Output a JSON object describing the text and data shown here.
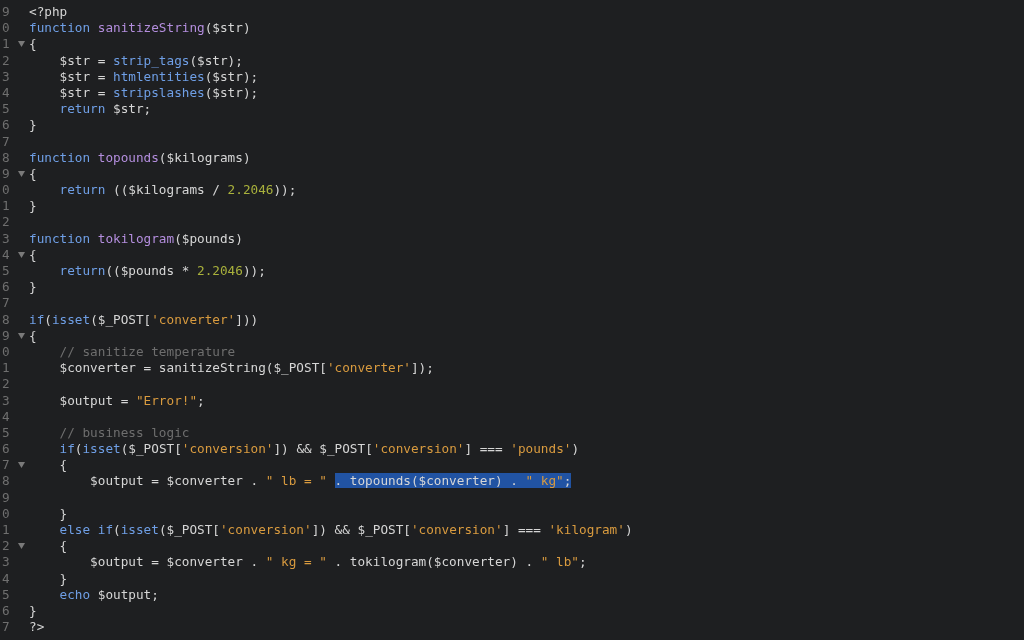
{
  "editor": {
    "lines": [
      {
        "number": "9",
        "foldable": false,
        "tokens": [
          {
            "kind": "plain",
            "text": "<?php",
            "selected": false
          }
        ]
      },
      {
        "number": "0",
        "foldable": false,
        "tokens": [
          {
            "kind": "keyword",
            "text": "function ",
            "selected": false
          },
          {
            "kind": "func",
            "text": "sanitizeString",
            "selected": false
          },
          {
            "kind": "plain",
            "text": "($str)",
            "selected": false
          }
        ]
      },
      {
        "number": "1",
        "foldable": true,
        "tokens": [
          {
            "kind": "plain",
            "text": "{",
            "selected": false
          }
        ]
      },
      {
        "number": "2",
        "foldable": false,
        "tokens": [
          {
            "kind": "plain",
            "text": "    $str = ",
            "selected": false
          },
          {
            "kind": "keyword",
            "text": "strip_tags",
            "selected": false
          },
          {
            "kind": "plain",
            "text": "($str);",
            "selected": false
          }
        ]
      },
      {
        "number": "3",
        "foldable": false,
        "tokens": [
          {
            "kind": "plain",
            "text": "    $str = ",
            "selected": false
          },
          {
            "kind": "keyword",
            "text": "htmlentities",
            "selected": false
          },
          {
            "kind": "plain",
            "text": "($str);",
            "selected": false
          }
        ]
      },
      {
        "number": "4",
        "foldable": false,
        "tokens": [
          {
            "kind": "plain",
            "text": "    $str = ",
            "selected": false
          },
          {
            "kind": "keyword",
            "text": "stripslashes",
            "selected": false
          },
          {
            "kind": "plain",
            "text": "($str);",
            "selected": false
          }
        ]
      },
      {
        "number": "5",
        "foldable": false,
        "tokens": [
          {
            "kind": "keyword",
            "text": "    return",
            "selected": false
          },
          {
            "kind": "plain",
            "text": " $str;",
            "selected": false
          }
        ]
      },
      {
        "number": "6",
        "foldable": false,
        "tokens": [
          {
            "kind": "plain",
            "text": "}",
            "selected": false
          }
        ]
      },
      {
        "number": "7",
        "foldable": false
      },
      {
        "number": "8",
        "foldable": false,
        "tokens": [
          {
            "kind": "keyword",
            "text": "function ",
            "selected": false
          },
          {
            "kind": "func",
            "text": "topounds",
            "selected": false
          },
          {
            "kind": "plain",
            "text": "($kilograms)",
            "selected": false
          }
        ]
      },
      {
        "number": "9",
        "foldable": true,
        "tokens": [
          {
            "kind": "plain",
            "text": "{",
            "selected": false
          }
        ]
      },
      {
        "number": "0",
        "foldable": false,
        "tokens": [
          {
            "kind": "keyword",
            "text": "    return",
            "selected": false
          },
          {
            "kind": "plain",
            "text": " (($kilograms / ",
            "selected": false
          },
          {
            "kind": "number",
            "text": "2.2046",
            "selected": false
          },
          {
            "kind": "plain",
            "text": "));",
            "selected": false
          }
        ]
      },
      {
        "number": "1",
        "foldable": false,
        "tokens": [
          {
            "kind": "plain",
            "text": "}",
            "selected": false
          }
        ]
      },
      {
        "number": "2",
        "foldable": false
      },
      {
        "number": "3",
        "foldable": false,
        "tokens": [
          {
            "kind": "keyword",
            "text": "function ",
            "selected": false
          },
          {
            "kind": "func",
            "text": "tokilogram",
            "selected": false
          },
          {
            "kind": "plain",
            "text": "($pounds)",
            "selected": false
          }
        ]
      },
      {
        "number": "4",
        "foldable": true,
        "tokens": [
          {
            "kind": "plain",
            "text": "{",
            "selected": false
          }
        ]
      },
      {
        "number": "5",
        "foldable": false,
        "tokens": [
          {
            "kind": "keyword",
            "text": "    return",
            "selected": false
          },
          {
            "kind": "plain",
            "text": "(($pounds * ",
            "selected": false
          },
          {
            "kind": "number",
            "text": "2.2046",
            "selected": false
          },
          {
            "kind": "plain",
            "text": "));",
            "selected": false
          }
        ]
      },
      {
        "number": "6",
        "foldable": false,
        "tokens": [
          {
            "kind": "plain",
            "text": "}",
            "selected": false
          }
        ]
      },
      {
        "number": "7",
        "foldable": false
      },
      {
        "number": "8",
        "foldable": false,
        "tokens": [
          {
            "kind": "keyword",
            "text": "if",
            "selected": false
          },
          {
            "kind": "plain",
            "text": "(",
            "selected": false
          },
          {
            "kind": "keyword",
            "text": "isset",
            "selected": false
          },
          {
            "kind": "plain",
            "text": "($_POST[",
            "selected": false
          },
          {
            "kind": "string",
            "text": "'converter'",
            "selected": false
          },
          {
            "kind": "plain",
            "text": "]))",
            "selected": false
          }
        ]
      },
      {
        "number": "9",
        "foldable": true,
        "tokens": [
          {
            "kind": "plain",
            "text": "{",
            "selected": false
          }
        ]
      },
      {
        "number": "0",
        "foldable": false,
        "tokens": [
          {
            "kind": "comment",
            "text": "    // sanitize temperature",
            "selected": false
          }
        ]
      },
      {
        "number": "1",
        "foldable": false,
        "tokens": [
          {
            "kind": "plain",
            "text": "    $converter = sanitizeString($_POST[",
            "selected": false
          },
          {
            "kind": "string",
            "text": "'converter'",
            "selected": false
          },
          {
            "kind": "plain",
            "text": "]);",
            "selected": false
          }
        ]
      },
      {
        "number": "2",
        "foldable": false
      },
      {
        "number": "3",
        "foldable": false,
        "tokens": [
          {
            "kind": "plain",
            "text": "    $output = ",
            "selected": false
          },
          {
            "kind": "string",
            "text": "\"Error!\"",
            "selected": false
          },
          {
            "kind": "plain",
            "text": ";",
            "selected": false
          }
        ]
      },
      {
        "number": "4",
        "foldable": false
      },
      {
        "number": "5",
        "foldable": false,
        "tokens": [
          {
            "kind": "comment",
            "text": "    // business logic",
            "selected": false
          }
        ]
      },
      {
        "number": "6",
        "foldable": false,
        "tokens": [
          {
            "kind": "keyword",
            "text": "    if",
            "selected": false
          },
          {
            "kind": "plain",
            "text": "(",
            "selected": false
          },
          {
            "kind": "keyword",
            "text": "isset",
            "selected": false
          },
          {
            "kind": "plain",
            "text": "($_POST[",
            "selected": false
          },
          {
            "kind": "string",
            "text": "'conversion'",
            "selected": false
          },
          {
            "kind": "plain",
            "text": "]) && $_POST[",
            "selected": false
          },
          {
            "kind": "string",
            "text": "'conversion'",
            "selected": false
          },
          {
            "kind": "plain",
            "text": "] === ",
            "selected": false
          },
          {
            "kind": "string",
            "text": "'pounds'",
            "selected": false
          },
          {
            "kind": "plain",
            "text": ")",
            "selected": false
          }
        ]
      },
      {
        "number": "7",
        "foldable": true,
        "tokens": [
          {
            "kind": "plain",
            "text": "    {",
            "selected": false
          }
        ]
      },
      {
        "number": "8",
        "foldable": false,
        "tokens": [
          {
            "kind": "plain",
            "text": "        $output = $converter . ",
            "selected": false
          },
          {
            "kind": "string",
            "text": "\" lb = \" ",
            "selected": false
          },
          {
            "kind": "plain",
            "text": ". topounds($converter) . ",
            "selected": true
          },
          {
            "kind": "string",
            "text": "\" kg\"",
            "selected": true
          },
          {
            "kind": "plain",
            "text": ";",
            "selected": true
          }
        ]
      },
      {
        "number": "9",
        "foldable": false
      },
      {
        "number": "0",
        "foldable": false,
        "tokens": [
          {
            "kind": "plain",
            "text": "    }",
            "selected": false
          }
        ]
      },
      {
        "number": "1",
        "foldable": false,
        "tokens": [
          {
            "kind": "keyword",
            "text": "    else if",
            "selected": false
          },
          {
            "kind": "plain",
            "text": "(",
            "selected": false
          },
          {
            "kind": "keyword",
            "text": "isset",
            "selected": false
          },
          {
            "kind": "plain",
            "text": "($_POST[",
            "selected": false
          },
          {
            "kind": "string",
            "text": "'conversion'",
            "selected": false
          },
          {
            "kind": "plain",
            "text": "]) && $_POST[",
            "selected": false
          },
          {
            "kind": "string",
            "text": "'conversion'",
            "selected": false
          },
          {
            "kind": "plain",
            "text": "] === ",
            "selected": false
          },
          {
            "kind": "string",
            "text": "'kilogram'",
            "selected": false
          },
          {
            "kind": "plain",
            "text": ")",
            "selected": false
          }
        ]
      },
      {
        "number": "2",
        "foldable": true,
        "tokens": [
          {
            "kind": "plain",
            "text": "    {",
            "selected": false
          }
        ]
      },
      {
        "number": "3",
        "foldable": false,
        "tokens": [
          {
            "kind": "plain",
            "text": "        $output = $converter . ",
            "selected": false
          },
          {
            "kind": "string",
            "text": "\" kg = \"",
            "selected": false
          },
          {
            "kind": "plain",
            "text": " . tokilogram($converter) . ",
            "selected": false
          },
          {
            "kind": "string",
            "text": "\" lb\"",
            "selected": false
          },
          {
            "kind": "plain",
            "text": ";",
            "selected": false
          }
        ]
      },
      {
        "number": "4",
        "foldable": false,
        "tokens": [
          {
            "kind": "plain",
            "text": "    }",
            "selected": false
          }
        ]
      },
      {
        "number": "5",
        "foldable": false,
        "tokens": [
          {
            "kind": "keyword",
            "text": "    echo",
            "selected": false
          },
          {
            "kind": "plain",
            "text": " $output;",
            "selected": false
          }
        ]
      },
      {
        "number": "6",
        "foldable": false,
        "tokens": [
          {
            "kind": "plain",
            "text": "}",
            "selected": false
          }
        ]
      },
      {
        "number": "7",
        "foldable": false,
        "tokens": [
          {
            "kind": "plain",
            "text": "?>",
            "selected": false
          }
        ]
      }
    ]
  }
}
